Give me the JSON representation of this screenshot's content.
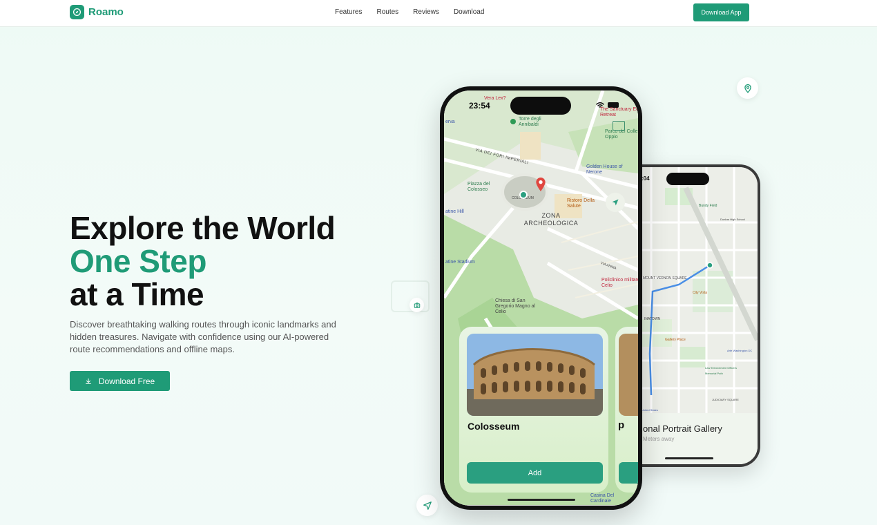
{
  "nav": {
    "brand": "Roamo",
    "links": [
      "Features",
      "Routes",
      "Reviews",
      "Download"
    ],
    "cta": "Download App"
  },
  "hero": {
    "title_line1": "Explore the World",
    "title_line2": "One Step",
    "title_line3": "at a Time",
    "description": "Discover breathtaking walking routes through iconic landmarks and hidden treasures. Navigate with confidence using our AI-powered route recommendations and offline maps.",
    "cta": "Download Free"
  },
  "front_phone": {
    "time": "23:54",
    "map_labels": {
      "vera_lex": "Vera Lex?",
      "torre": "Torre degli Annibaldi",
      "sanctuary": "The Sanctuary Eco Retreat",
      "parco": "Parco del Colle Oppio",
      "via_imperiali": "VIA DEI FORI IMPERIALI",
      "golden_house": "Golden House of Nerone",
      "piazza": "Piazza del Colosseo",
      "colosseum_pin": "COLOSSEUM",
      "ristoro": "Ristoro Della Salute",
      "zona": "ZONA ARCHEOLOGICA",
      "palatine": "atine Hill",
      "stadium": "atine Stadium",
      "via_annia": "VIA ANNIA",
      "policlinico": "Policlinico militare Celio",
      "chiesa": "Chiesa di San Gregorio Magno al Celio",
      "casina": "Casina Del Cardinale",
      "erva": "erva"
    },
    "card_title": "Colosseum",
    "card_button": "Add",
    "next_card_initial": "p"
  },
  "back_phone": {
    "time": ":04",
    "map_labels": {
      "bundy": "Bundy Field",
      "dunbar": "Dunbar High School",
      "mount_vernon": "MOUNT VERNON SQUARE",
      "city_vista": "City Vista",
      "chinatown": "INATOWN",
      "gallery_place": "Gallery Place",
      "arte": "Arte Washington DC",
      "law": "Law Enforcement Officers Memorial Path",
      "judiciary": "JUDICIARY SQUARE",
      "united_states": "United States"
    },
    "card_title": "onal Portrait Gallery",
    "card_sub": "Meters away"
  },
  "colors": {
    "brand": "#1f9b77",
    "brand_dark": "#178264",
    "bg": "#eefaf5"
  }
}
